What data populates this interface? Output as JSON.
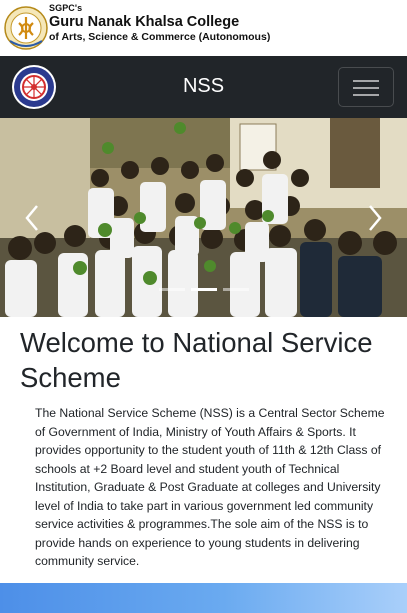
{
  "college": {
    "pre": "SGPC's",
    "name": "Guru Nanak Khalsa College",
    "subtitle": "of Arts, Science & Commerce (Autonomous)"
  },
  "navbar": {
    "title": "NSS",
    "logo_icon": "nss-emblem-icon",
    "menu_icon": "hamburger-menu-icon"
  },
  "carousel": {
    "slide_count": 3,
    "active_index": 1,
    "prev_icon": "chevron-left-icon",
    "next_icon": "chevron-right-icon"
  },
  "welcome": {
    "title": "Welcome to National Service Scheme",
    "body": "The National Service Scheme (NSS) is a Central Sector Scheme of Government of India, Ministry of Youth Affairs & Sports. It provides opportunity to the student youth of 11th & 12th Class of schools at +2 Board level and student youth of Technical Institution, Graduate & Post Graduate at colleges and University level of India to take part in various government led community service activities & programmes.The sole aim of the NSS is to provide hands on experience to young students in delivering community service."
  },
  "colors": {
    "navbar_bg": "#212529",
    "band_start": "#4d8fe8",
    "band_end": "#a9cffa"
  }
}
